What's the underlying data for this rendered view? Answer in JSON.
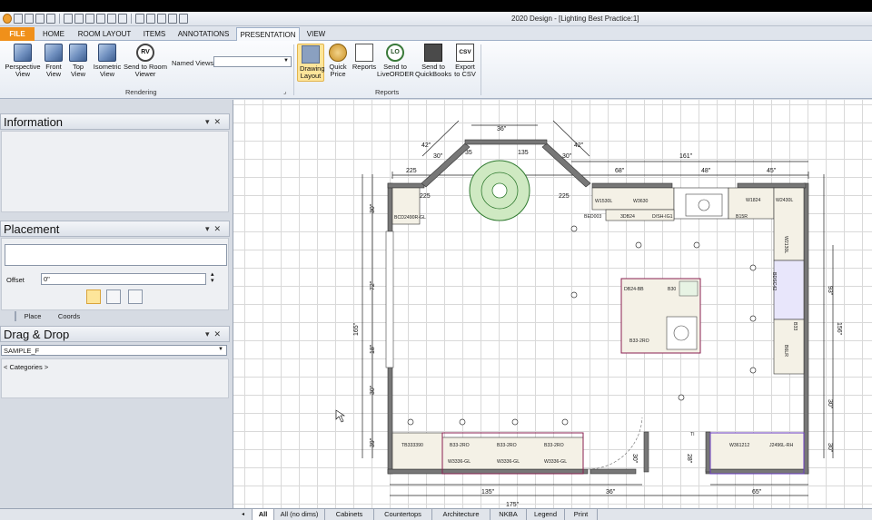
{
  "window": {
    "title": "2020 Design - [Lighting Best Practice:1]"
  },
  "tabs": [
    "FILE",
    "HOME",
    "ROOM LAYOUT",
    "ITEMS",
    "ANNOTATIONS",
    "PRESENTATION",
    "VIEW"
  ],
  "active_tab": "PRESENTATION",
  "ribbon": {
    "rendering": {
      "group_label": "Rendering",
      "buttons": [
        "Perspective View",
        "Front View",
        "Top View",
        "Isometric View",
        "Send to Room Viewer"
      ],
      "named_views_label": "Named Views",
      "named_views_value": ""
    },
    "reports": {
      "group_label": "Reports",
      "buttons": [
        "Drawing Layout",
        "Quick Price",
        "Reports",
        "Send to LiveORDER",
        "Send to QuickBooks",
        "Export to CSV"
      ],
      "selected": "Drawing Layout",
      "rv_glyph": "RV",
      "lo_glyph": "LO",
      "csv_glyph": "CSV"
    }
  },
  "panels": {
    "information": {
      "title": "Information"
    },
    "placement": {
      "title": "Placement",
      "offset_label": "Offset",
      "offset_value": "0\"",
      "tabs": [
        "Place",
        "Coords"
      ]
    },
    "drag_drop": {
      "title": "Drag & Drop",
      "catalog_value": "SAMPLE_F",
      "categories_label": "< Categories >"
    }
  },
  "plan": {
    "dims": {
      "top_left_angle": "42\"",
      "top_left_inner": "30\"",
      "top_center": "36\"",
      "top_right_angle": "42\"",
      "top_right_inner": "30\"",
      "corner_left": "35",
      "corner_right": "135",
      "overall_top": "161\"",
      "top_seg1": "68\"",
      "top_seg2": "48\"",
      "top_seg3": "45\"",
      "left_overall": "165\"",
      "left_seg1": "30\"",
      "left_seg2": "72\"",
      "left_seg3": "18\"",
      "left_seg4": "30\"",
      "left_seg5": "39\"",
      "right_seg1": "93\"",
      "right_overall": "156\"",
      "right_seg2": "30\"",
      "right_seg3": "30\"",
      "bottom_left": "135\"",
      "bottom_mid": "36\"",
      "bottom_right": "65\"",
      "bottom_overall": "175\"",
      "side_mid1": "30\"",
      "side_mid2": "28\"",
      "left_corner_label": "225",
      "right_corner_label": "225"
    },
    "labels": {
      "w1530l": "W1530L",
      "w3630": "W3630",
      "w3630r": "W3630R",
      "w1824": "W1824",
      "b15r": "B15R",
      "w2430l": "W2430L",
      "w2130l": "W2130L",
      "b3b24": "3DB24",
      "dsh": "D/SH-IG1",
      "bed": "BED003",
      "bcd": "BCD2490R-GL",
      "db": "DB24-BB",
      "b30": "B30",
      "b33": "B33-2RO",
      "tb": "TB333390",
      "b33a": "B33-2RO",
      "b33b": "B33-2RO",
      "b33c": "B33-2RO",
      "w3336a": "W3336-GL",
      "w3336b": "W3336-GL",
      "w3336c": "W3336-GL",
      "w361212": "W361212",
      "j2496": "J2496L-RH",
      "ti": "TI",
      "bdsc": "BDSC42",
      "b3": "B33",
      "b6": "B6LR"
    }
  },
  "bottom_tabs": [
    "All",
    "All (no dims)",
    "Cabinets",
    "Countertops",
    "Architecture",
    "NKBA",
    "Legend",
    "Print"
  ],
  "active_bottom_tab": "All",
  "scroll_glyph": "|||"
}
